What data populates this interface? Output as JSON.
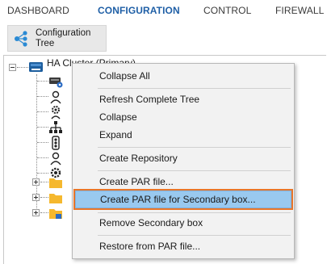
{
  "nav": {
    "tabs": [
      {
        "label": "DASHBOARD",
        "active": false
      },
      {
        "label": "CONFIGURATION",
        "active": true
      },
      {
        "label": "CONTROL",
        "active": false
      },
      {
        "label": "FIREWALL",
        "active": false
      }
    ],
    "active_color": "#1f5fa6"
  },
  "ribbon": {
    "button_label": "Configuration\nTree",
    "button_icon": "configuration-tree-icon"
  },
  "tree": {
    "root_label": "HA Cluster (Primary)",
    "root_icon": "box-server-icon",
    "children": [
      {
        "icon": "server-settings-icon"
      },
      {
        "icon": "user-admin-icon"
      },
      {
        "icon": "gear-user-icon"
      },
      {
        "icon": "network-tree-icon"
      },
      {
        "icon": "traffic-light-icon"
      },
      {
        "icon": "user-icon"
      },
      {
        "icon": "settings-icon"
      },
      {
        "icon": "folder-icon",
        "expandable": true
      },
      {
        "icon": "folder-icon",
        "expandable": true
      },
      {
        "icon": "folder-settings-icon",
        "expandable": true
      }
    ]
  },
  "context_menu": {
    "items": [
      {
        "label": "Collapse All"
      },
      {
        "label": "Refresh Complete Tree"
      },
      {
        "label": "Collapse"
      },
      {
        "label": "Expand"
      },
      {
        "label": "Create Repository"
      },
      {
        "label": "Create PAR file..."
      },
      {
        "label": "Create PAR file for Secondary box...",
        "selected": true
      },
      {
        "label": "Remove Secondary box"
      },
      {
        "label": "Restore from PAR file..."
      }
    ],
    "highlight_color": "#99c9ef",
    "focus_outline_color": "#e8762a"
  }
}
